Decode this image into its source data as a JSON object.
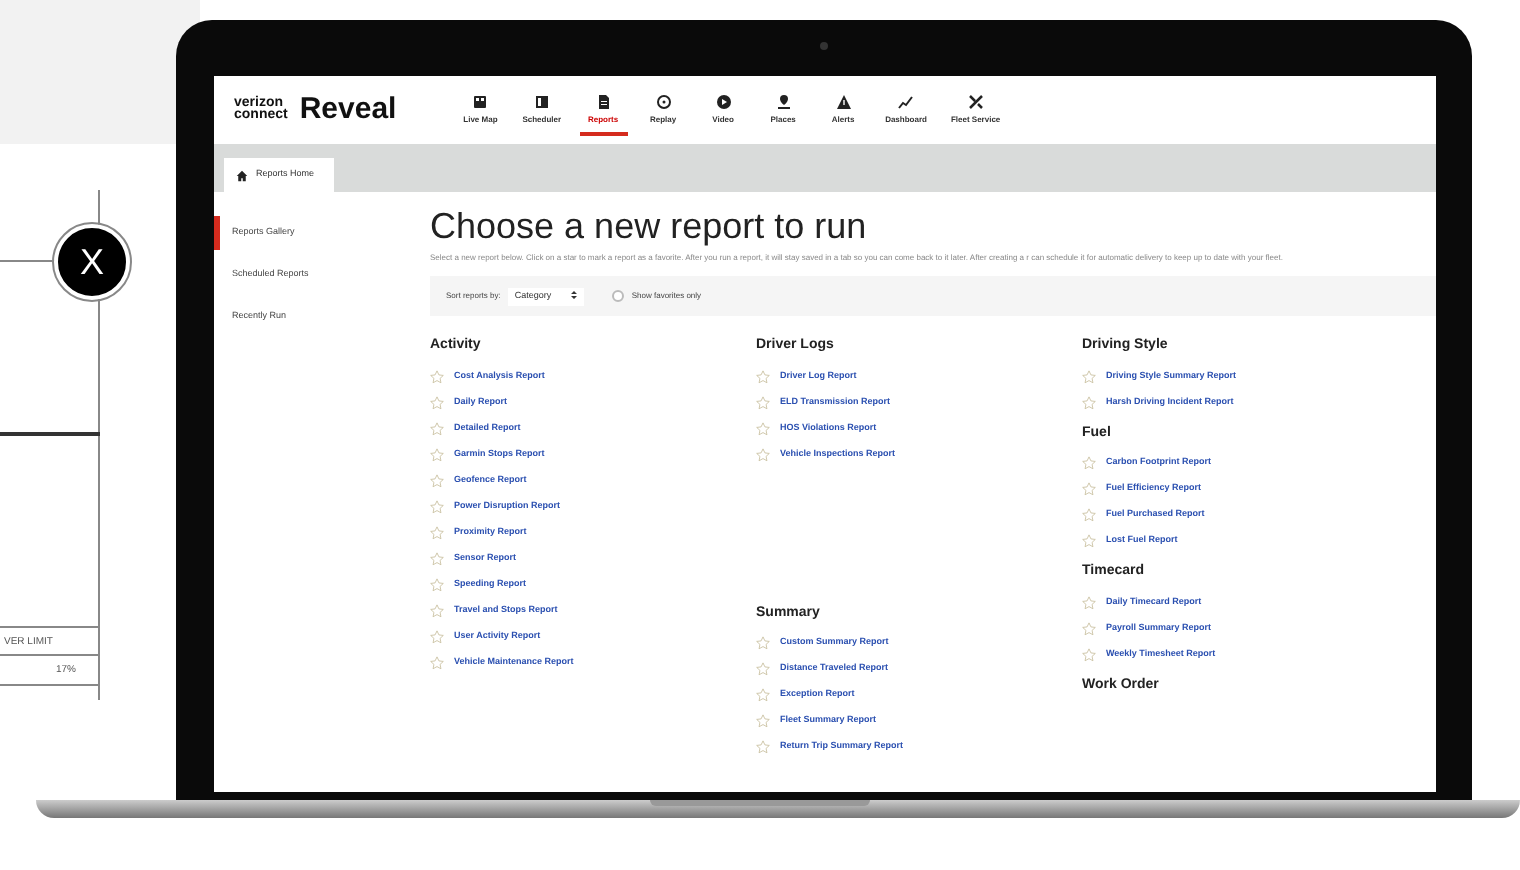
{
  "background_card": {
    "close_label": "X",
    "column_header": "VER LIMIT",
    "cell": "17%"
  },
  "app": {
    "logo_line1": "verizon",
    "logo_line2": "connect",
    "product": "Reveal",
    "nav": [
      {
        "label": "Live Map",
        "selected": false
      },
      {
        "label": "Scheduler",
        "selected": false
      },
      {
        "label": "Reports",
        "selected": true
      },
      {
        "label": "Replay",
        "selected": false
      },
      {
        "label": "Video",
        "selected": false
      },
      {
        "label": "Places",
        "selected": false
      },
      {
        "label": "Alerts",
        "selected": false
      },
      {
        "label": "Dashboard",
        "selected": false
      },
      {
        "label": "Fleet Service",
        "selected": false
      }
    ],
    "tab": "Reports Home",
    "sidebar": [
      {
        "label": "Reports Gallery",
        "selected": true
      },
      {
        "label": "Scheduled Reports",
        "selected": false
      },
      {
        "label": "Recently Run",
        "selected": false
      }
    ],
    "title": "Choose a new report to run",
    "description": "Select a new report below. Click on a star to mark a report as a favorite. After you run a report, it will stay saved in a tab so you can come back to it later. After creating a r can schedule it for automatic delivery to keep up to date with your fleet.",
    "sort": {
      "label": "Sort reports by:",
      "value": "Category",
      "favorites_label": "Show favorites only",
      "favorites_only": false
    },
    "columns": [
      {
        "groups": [
          {
            "title": "Activity",
            "reports": [
              {
                "label": "Cost Analysis Report",
                "favorite": false
              },
              {
                "label": "Daily Report",
                "favorite": false
              },
              {
                "label": "Detailed Report",
                "favorite": false
              },
              {
                "label": "Garmin Stops Report",
                "favorite": false
              },
              {
                "label": "Geofence Report",
                "favorite": false
              },
              {
                "label": "Power Disruption Report",
                "favorite": false
              },
              {
                "label": "Proximity Report",
                "favorite": false
              },
              {
                "label": "Sensor Report",
                "favorite": false
              },
              {
                "label": "Speeding Report",
                "favorite": false
              },
              {
                "label": "Travel and Stops Report",
                "favorite": false
              },
              {
                "label": "User Activity Report",
                "favorite": false
              },
              {
                "label": "Vehicle Maintenance Report",
                "favorite": false
              }
            ]
          }
        ]
      },
      {
        "groups": [
          {
            "title": "Driver Logs",
            "reports": [
              {
                "label": "Driver Log Report",
                "favorite": false
              },
              {
                "label": "ELD Transmission Report",
                "favorite": false
              },
              {
                "label": "HOS Violations Report",
                "favorite": false
              },
              {
                "label": "Vehicle Inspections Report",
                "favorite": false
              }
            ]
          },
          {
            "title": "Summary",
            "reports": [
              {
                "label": "Custom Summary Report",
                "favorite": false
              },
              {
                "label": "Distance Traveled Report",
                "favorite": false
              },
              {
                "label": "Exception Report",
                "favorite": false
              },
              {
                "label": "Fleet Summary Report",
                "favorite": false
              },
              {
                "label": "Return Trip Summary Report",
                "favorite": false
              }
            ]
          }
        ]
      },
      {
        "groups": [
          {
            "title": "Driving Style",
            "reports": [
              {
                "label": "Driving Style Summary Report",
                "favorite": false
              },
              {
                "label": "Harsh Driving Incident Report",
                "favorite": false
              }
            ]
          },
          {
            "title": "Fuel",
            "reports": [
              {
                "label": "Carbon Footprint Report",
                "favorite": false
              },
              {
                "label": "Fuel Efficiency Report",
                "favorite": false
              },
              {
                "label": "Fuel Purchased Report",
                "favorite": false
              },
              {
                "label": "Lost Fuel Report",
                "favorite": false
              }
            ]
          },
          {
            "title": "Timecard",
            "reports": [
              {
                "label": "Daily Timecard Report",
                "favorite": false
              },
              {
                "label": "Payroll Summary Report",
                "favorite": false
              },
              {
                "label": "Weekly Timesheet Report",
                "favorite": false
              }
            ]
          },
          {
            "title": "Work Order"
          }
        ]
      }
    ]
  }
}
